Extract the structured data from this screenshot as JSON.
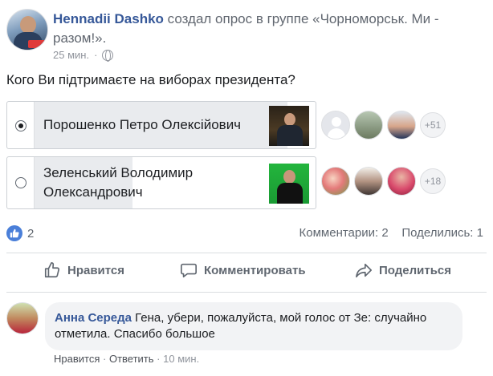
{
  "post": {
    "author": "Hennadii Dashko",
    "action_text": " создал опрос в группе «Чорноморськ. Ми - разом!».",
    "time": "25 мин.",
    "privacy_icon": "globe-icon"
  },
  "poll": {
    "question": "Кого Ви підтримаєте на виборах президента?",
    "options": [
      {
        "label": "Порошенко Петро Олексійович",
        "selected": true,
        "fill_fraction": 0.9,
        "more_votes": "+51"
      },
      {
        "label_line1": "Зеленський Володимир",
        "label_line2": "Олександрович",
        "selected": false,
        "fill_fraction": 0.35,
        "more_votes": "+18"
      }
    ]
  },
  "reactions": {
    "like_count": "2",
    "comments": "Комментарии: 2",
    "shares": "Поделились: 1"
  },
  "actions": {
    "like": "Нравится",
    "comment": "Комментировать",
    "share": "Поделиться"
  },
  "comment": {
    "author": "Анна Середа",
    "text": " Гена, убери, пожалуйста, мой голос от Зе: случайно отметила. Спасибо большое",
    "like": "Нравится",
    "reply": "Ответить",
    "separator": "·",
    "time": "10 мин."
  },
  "colors": {
    "link": "#365899",
    "like_blue": "#4a7fd9",
    "poll_fill": "#e9ebee"
  }
}
